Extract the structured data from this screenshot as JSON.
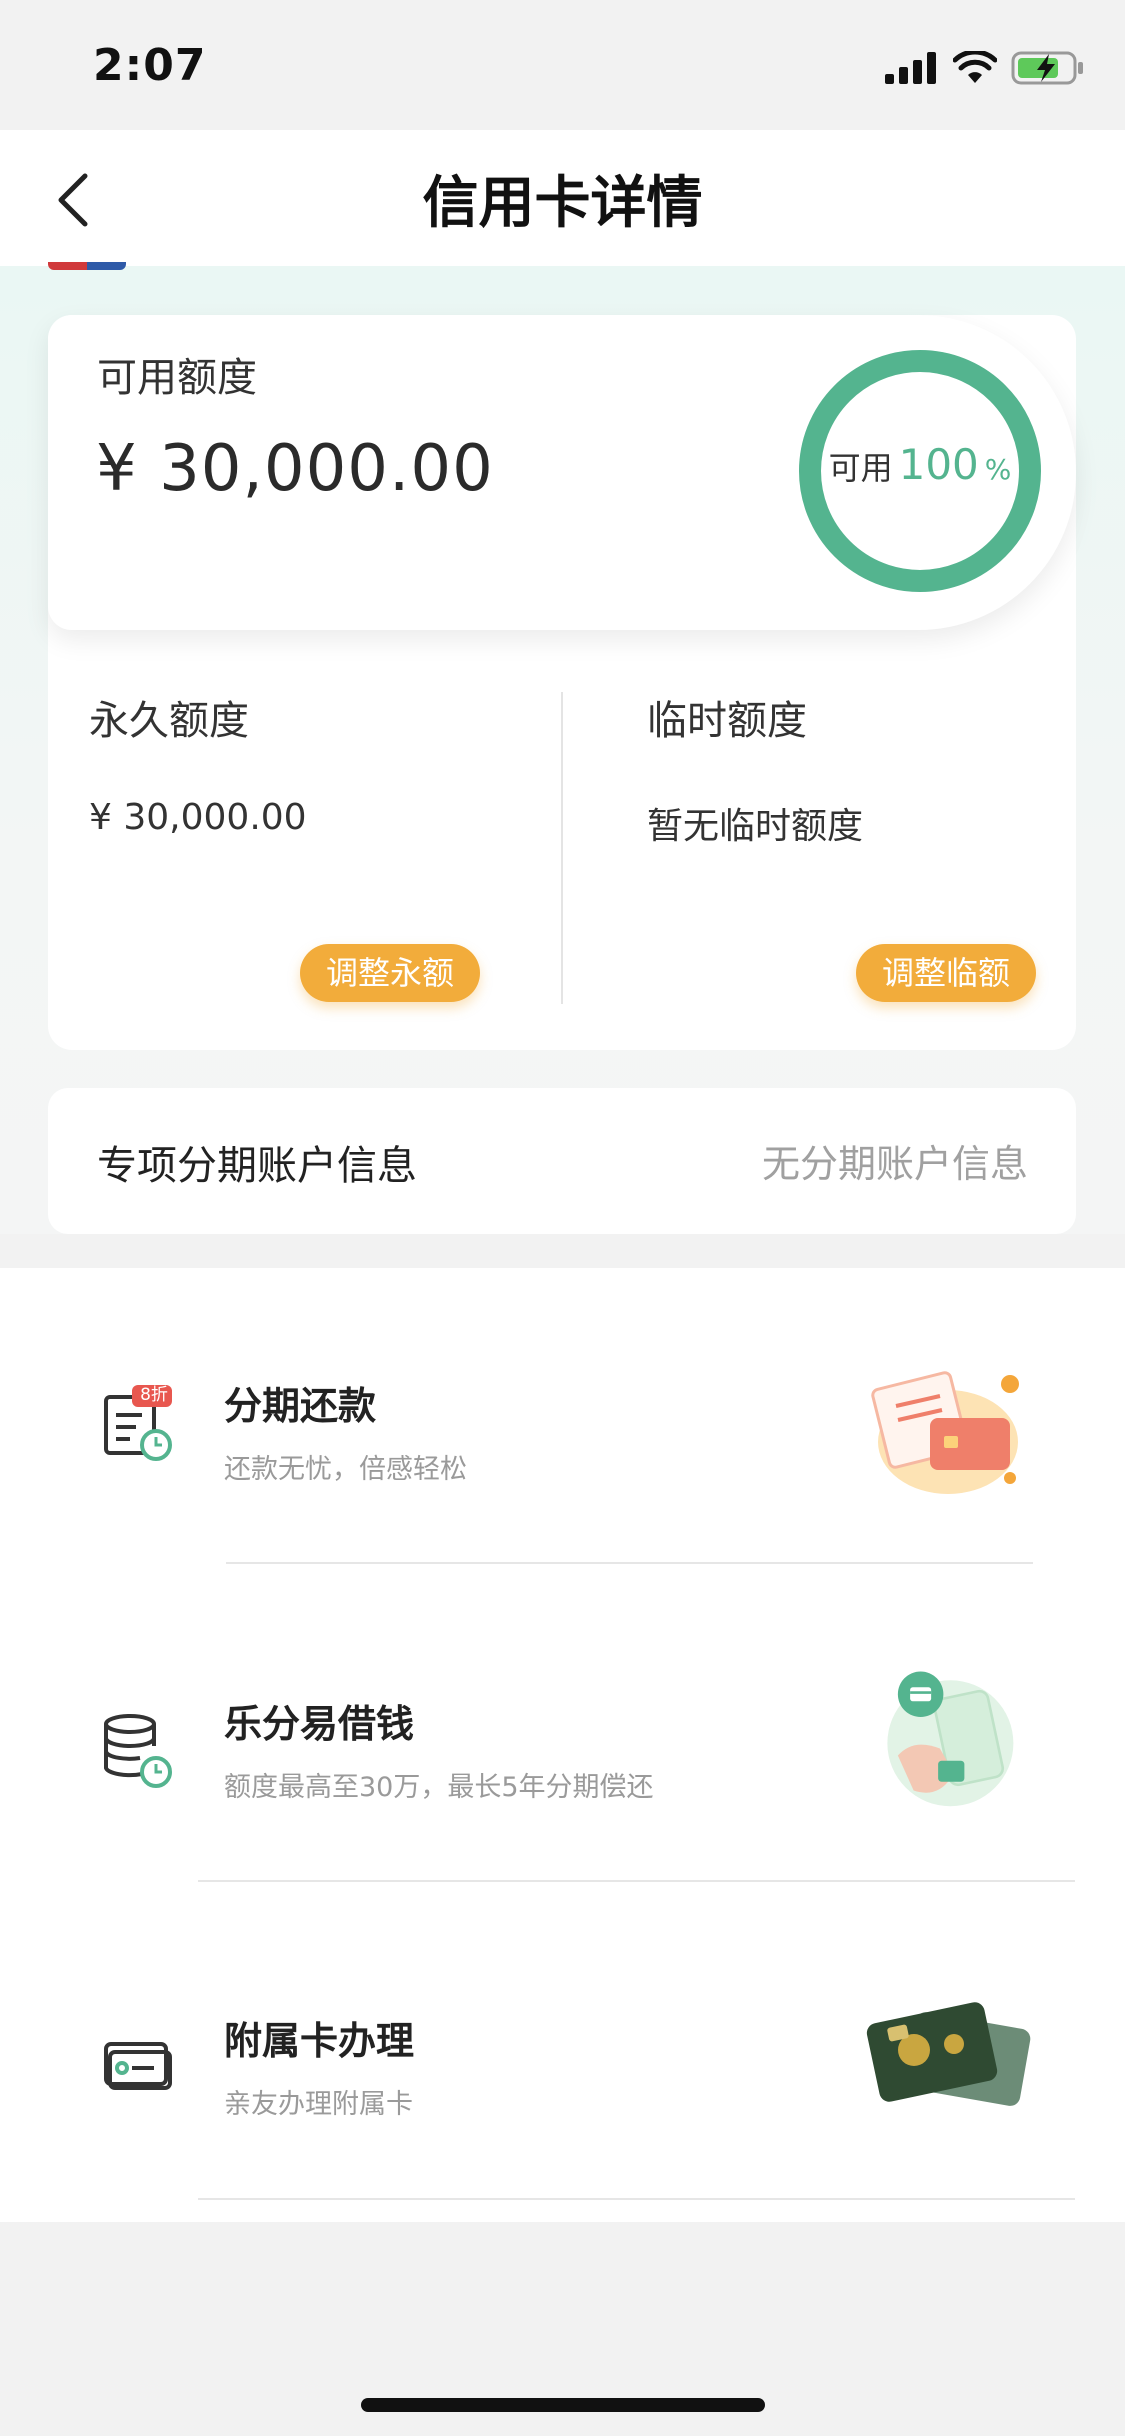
{
  "status_bar": {
    "time": "2:07"
  },
  "nav": {
    "title": "信用卡详情"
  },
  "available": {
    "label": "可用额度",
    "amount": "¥ 30,000.00",
    "ring_label": "可用",
    "ring_percent": "100",
    "ring_percent_sign": "%",
    "ring_fraction": 1.0
  },
  "permanent": {
    "label": "永久额度",
    "value": "¥ 30,000.00",
    "button": "调整永额"
  },
  "temporary": {
    "label": "临时额度",
    "value": "暂无临时额度",
    "button": "调整临额"
  },
  "installment_account": {
    "label": "专项分期账户信息",
    "value": "无分期账户信息"
  },
  "list": [
    {
      "title": "分期还款",
      "subtitle": "还款无忧，倍感轻松",
      "badge": "8折",
      "icon": "bill-clock-icon"
    },
    {
      "title": "乐分易借钱",
      "subtitle": "额度最高至30万，最长5年分期偿还",
      "icon": "coins-clock-icon"
    },
    {
      "title": "附属卡办理",
      "subtitle": "亲友办理附属卡",
      "icon": "card-icon"
    }
  ],
  "colors": {
    "accent_green": "#54b48f",
    "button_orange": "#f2ac3b"
  }
}
